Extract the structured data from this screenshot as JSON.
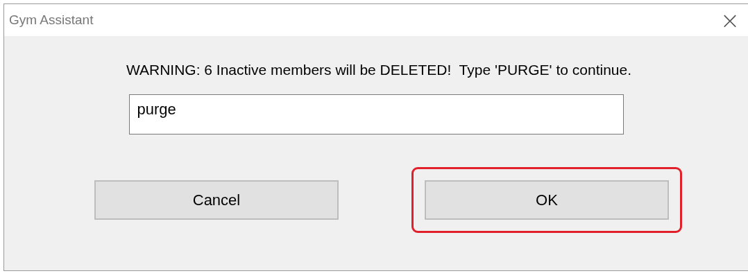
{
  "window": {
    "title": "Gym Assistant",
    "close": "×"
  },
  "message": "WARNING: 6 Inactive members will be DELETED!  Type 'PURGE' to continue.",
  "input": {
    "value": "purge"
  },
  "buttons": [
    {
      "label": "Cancel",
      "highlighted": false
    },
    {
      "label": "OK",
      "highlighted": true
    }
  ]
}
